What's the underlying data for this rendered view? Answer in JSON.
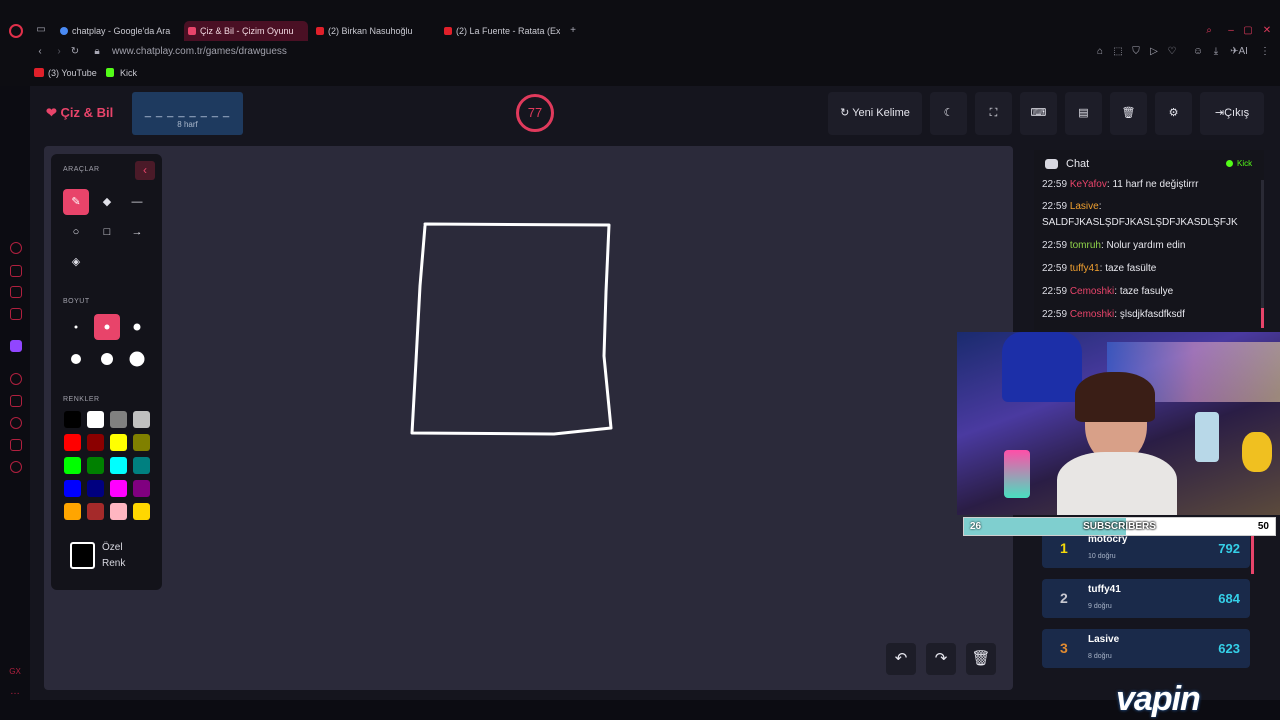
{
  "browser": {
    "tabs": [
      {
        "label": "chatplay - Google'da Ara",
        "active": false
      },
      {
        "label": "Çiz & Bil - Çizim Oyunu",
        "active": true
      },
      {
        "label": "(2) Birkan Nasuhoğlu",
        "active": false
      },
      {
        "label": "(2) La Fuente - Ratata (Ex",
        "active": false
      }
    ],
    "url": "www.chatplay.com.tr/games/drawguess",
    "bookmarks": [
      "(3) YouTube",
      "Kick"
    ],
    "ai_label": "AI"
  },
  "header": {
    "logo": "Çiz & Bil",
    "word_mask": "_ _ _ _ _ _ _ _",
    "word_count": "8 harf",
    "timer": "77",
    "new_word_label": "Yeni Kelime",
    "exit_label": "Çıkış"
  },
  "tools": {
    "tools_heading": "ARAÇLAR",
    "size_heading": "BOYUT",
    "colors_heading": "RENKLER",
    "custom_label_line1": "Özel",
    "custom_label_line2": "Renk",
    "active_tool": "brush",
    "active_size_index": 1,
    "palette": [
      "#000000",
      "#ffffff",
      "#808080",
      "#c0c0c0",
      "#ff0000",
      "#8b0000",
      "#ffff00",
      "#808000",
      "#00ff00",
      "#008000",
      "#00ffff",
      "#008080",
      "#0000ff",
      "#000080",
      "#ff00ff",
      "#800080",
      "#ffa500",
      "#a52a2a",
      "#ffb6c1",
      "#ffd700"
    ]
  },
  "chat": {
    "title": "Chat",
    "platform": "Kick",
    "messages": [
      {
        "time": "22:59",
        "user": "KeYafov",
        "text": "11 harf ne değiştirrr",
        "color": "#e8446a"
      },
      {
        "time": "22:59",
        "user": "Lasive",
        "text": "SALDFJKASLŞDFJKASLŞDFJKASDLŞFJK",
        "color": "#f0a030"
      },
      {
        "time": "22:59",
        "user": "tomruh",
        "text": "Nolur yardım edin",
        "color": "#8fd34a"
      },
      {
        "time": "22:59",
        "user": "tuffy41",
        "text": "taze fasülte",
        "color": "#f0a030"
      },
      {
        "time": "22:59",
        "user": "Cemoshki",
        "text": "taze fasulye",
        "color": "#e8446a"
      },
      {
        "time": "22:59",
        "user": "Cemoshki",
        "text": "şlsdjkfasdfksdf",
        "color": "#e8446a"
      }
    ]
  },
  "subscribers": {
    "label": "SUBSCRIBERS",
    "current": "26",
    "goal": "50",
    "progress_fraction": 0.52
  },
  "leaderboard": [
    {
      "rank": "1",
      "name": "motocry",
      "correct": "10 doğru",
      "score": "792",
      "rank_color": "#f5d90a"
    },
    {
      "rank": "2",
      "name": "tuffy41",
      "correct": "9 doğru",
      "score": "684",
      "rank_color": "#c8c8d0"
    },
    {
      "rank": "3",
      "name": "Lasive",
      "correct": "8 doğru",
      "score": "623",
      "rank_color": "#e08a30"
    }
  ],
  "watermark": "vapin",
  "colors": {
    "accent": "#e8446a",
    "canvas_bg": "#2b2a3a",
    "score": "#35d0e8"
  }
}
